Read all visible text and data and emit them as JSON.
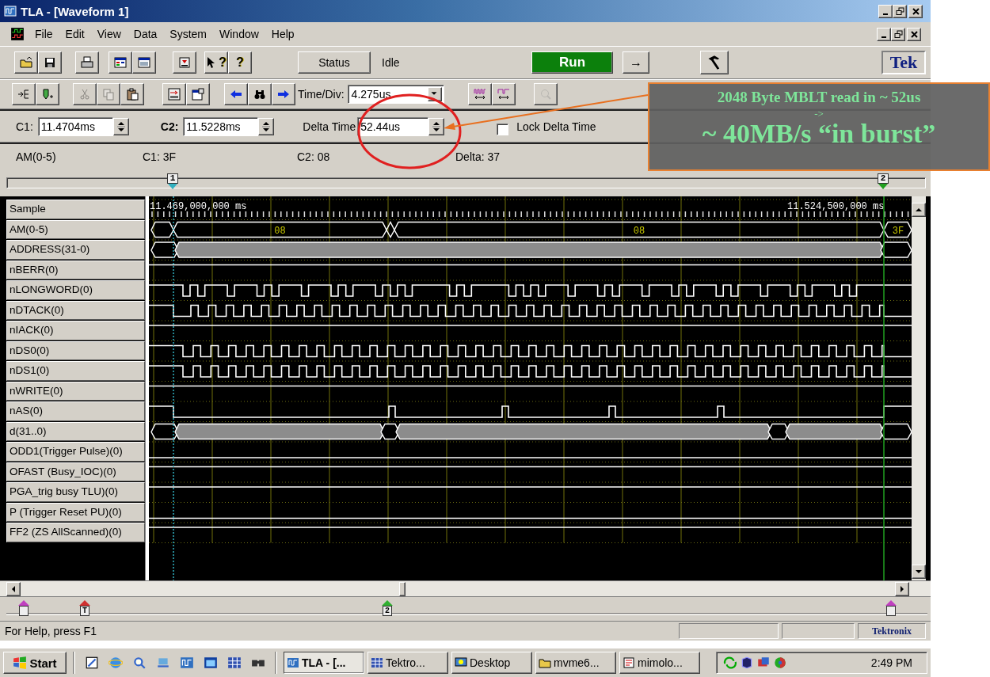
{
  "window": {
    "title": "TLA - [Waveform 1]"
  },
  "menu": [
    "File",
    "Edit",
    "View",
    "Data",
    "System",
    "Window",
    "Help"
  ],
  "toolbar": {
    "buttons": [
      {
        "kind": "open"
      },
      {
        "kind": "save"
      },
      {
        "kind": "print"
      },
      {
        "kind": "window"
      },
      {
        "kind": "new-window"
      },
      {
        "kind": "tray"
      },
      {
        "kind": "help-pointer",
        "text": "?"
      },
      {
        "kind": "help",
        "text": "?"
      }
    ],
    "status_button": "Status",
    "status": "Idle",
    "run_button": "Run",
    "step_button": "→",
    "logo": "Tek"
  },
  "toolbar2": {
    "buttons": [
      {
        "kind": "insert",
        "disabled": false
      },
      {
        "kind": "add",
        "disabled": false
      },
      {
        "kind": "cut",
        "disabled": true
      },
      {
        "kind": "copy",
        "disabled": true
      },
      {
        "kind": "paste",
        "disabled": false
      },
      {
        "kind": "goto",
        "disabled": false
      },
      {
        "kind": "properties",
        "disabled": false
      },
      {
        "kind": "prev",
        "disabled": false
      },
      {
        "kind": "find",
        "disabled": false
      },
      {
        "kind": "next",
        "disabled": false
      }
    ],
    "time_div_label": "Time/Div:",
    "time_div": "4.275us",
    "view_buttons": [
      {
        "kind": "zoom-in",
        "disabled": false
      },
      {
        "kind": "zoom-out",
        "disabled": false
      },
      {
        "kind": "magnify",
        "disabled": true
      }
    ]
  },
  "cursors": {
    "c1_label": "C1:",
    "c1": "11.4704ms",
    "c2_label": "C2:",
    "c2": "11.5228ms",
    "delta_label": "Delta Time",
    "delta": "52.44us",
    "lock": {
      "label": "Lock Delta Time",
      "checked": false
    }
  },
  "readout": [
    "AM(0-5)",
    "C1: 3F",
    "C2: 08",
    "Delta: 37"
  ],
  "waveform": {
    "cursors": [
      {
        "label": "1",
        "color": "#30b0c0"
      },
      {
        "label": "2",
        "color": "#20a020"
      }
    ],
    "signals": [
      {
        "name": "Sample",
        "kind": "time",
        "labels": [
          "11.469,000,000 ms",
          "11.524,500,000 ms"
        ]
      },
      {
        "name": "AM(0-5)",
        "kind": "bus",
        "labels": [
          "08",
          "08",
          "3F"
        ]
      },
      {
        "name": "ADDRESS(31-0)",
        "kind": "address-bus"
      },
      {
        "name": "nBERR(0)",
        "kind": "high"
      },
      {
        "name": "nLONGWORD(0)",
        "kind": "burst"
      },
      {
        "name": "nDTACK(0)",
        "kind": "clock"
      },
      {
        "name": "nIACK(0)",
        "kind": "high"
      },
      {
        "name": "nDS0(0)",
        "kind": "clock-wide"
      },
      {
        "name": "nDS1(0)",
        "kind": "clock-wide"
      },
      {
        "name": "nWRITE(0)",
        "kind": "high"
      },
      {
        "name": "nAS(0)",
        "kind": "strobe"
      },
      {
        "name": "d(31..0)",
        "kind": "data-bus"
      },
      {
        "name": "ODD1(Trigger Pulse)(0)",
        "kind": "low"
      },
      {
        "name": "OFAST (Busy_IOC)(0)",
        "kind": "high"
      },
      {
        "name": "PGA_trig busy TLU)(0)",
        "kind": "high"
      },
      {
        "name": "P (Trigger Reset PU)(0)",
        "kind": "low"
      },
      {
        "name": "FF2 (ZS AllScanned)(0)",
        "kind": "high"
      }
    ],
    "markers": [
      {
        "color": "#c040c0"
      },
      {
        "color": "#d03030",
        "label": "T"
      },
      {
        "color": "#30b030",
        "label": "2"
      },
      {
        "color": "#c040c0"
      }
    ]
  },
  "status_bar": {
    "help": "For Help, press F1",
    "brand": "Tektronix"
  },
  "taskbar": {
    "start": "Start",
    "tasks": [
      {
        "label": "TLA - [...",
        "kind": "waveform",
        "selected": true
      },
      {
        "label": "Tektro...",
        "kind": "grid",
        "selected": false
      },
      {
        "label": "Desktop",
        "kind": "desktop",
        "selected": false
      },
      {
        "label": "mvme6...",
        "kind": "folder",
        "selected": false
      },
      {
        "label": "mimolo...",
        "kind": "app",
        "selected": false
      }
    ],
    "clock": "2:49 PM"
  },
  "annotation": {
    "lines": [
      "2048 Byte MBLT read in ~ 52us",
      "->",
      "~ 40MB/s “in burst”"
    ]
  }
}
